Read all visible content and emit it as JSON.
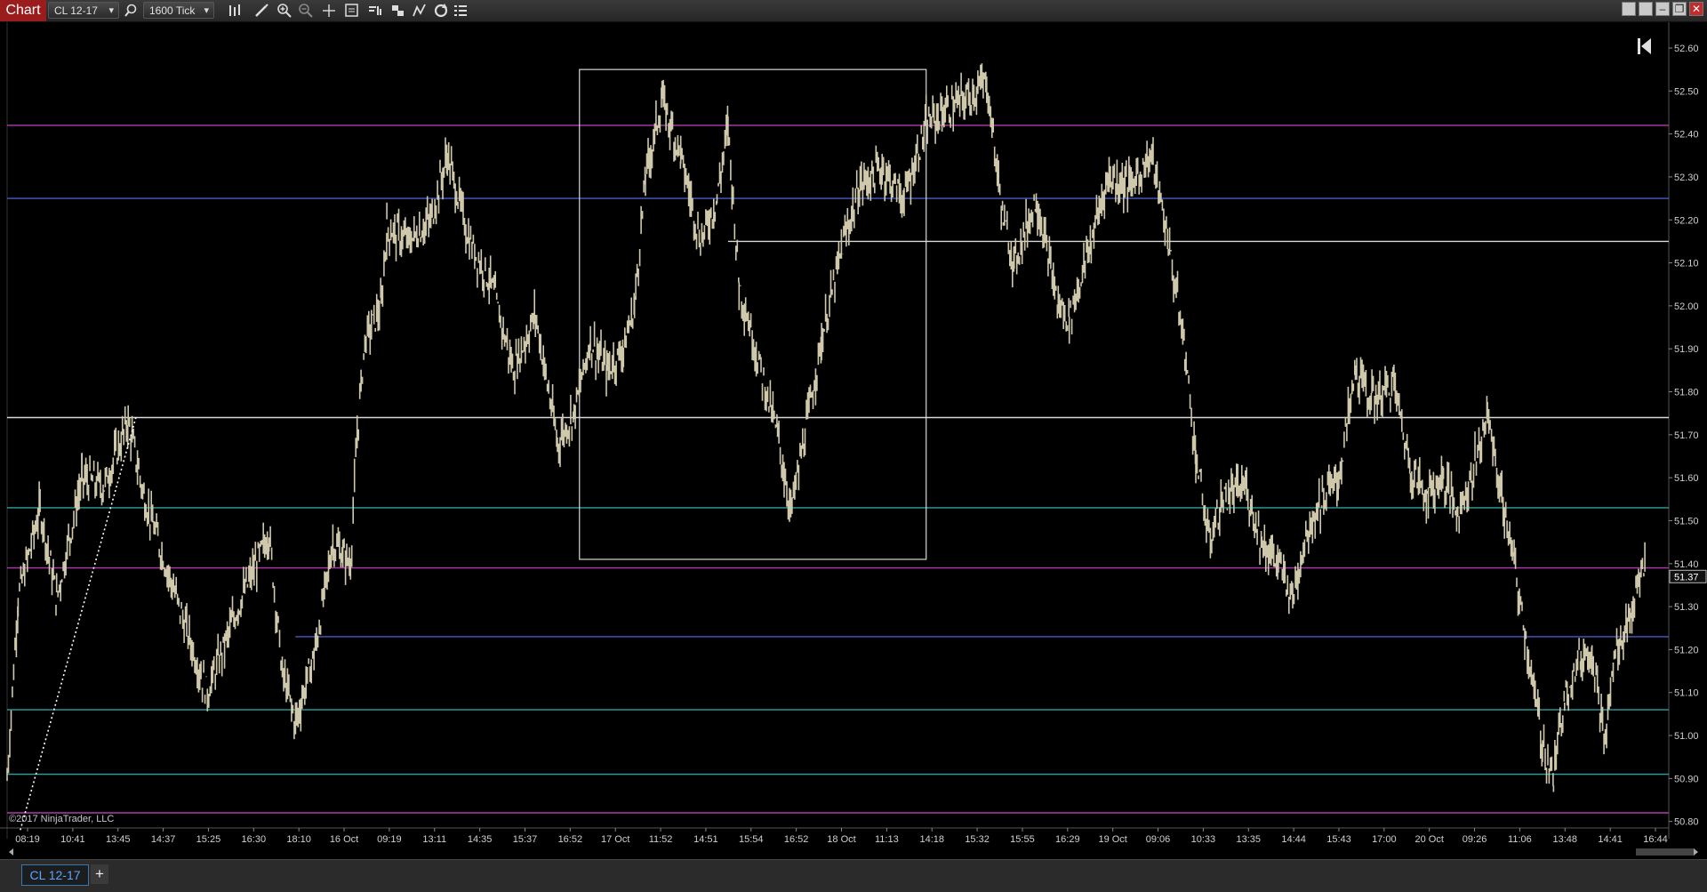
{
  "toolbar": {
    "chart_label": "Chart",
    "instrument": "CL 12-17",
    "interval": "1600 Tick",
    "icons": [
      "search-icon",
      "bar-style-icon",
      "draw-pencil-icon",
      "zoom-in-icon",
      "zoom-out-icon",
      "crosshair-icon",
      "data-box-icon",
      "indicators-icon",
      "strategies-icon",
      "drawing-tools-icon",
      "refresh-icon",
      "properties-icon"
    ],
    "window_buttons": [
      "tile-icon",
      "layout-icon",
      "minimize-icon",
      "restore-icon",
      "close-icon"
    ]
  },
  "colors": {
    "background": "#000000",
    "price_bar": "#cfc8aa",
    "magenta_line": "#b03ab0",
    "blue_line": "#4a5ac8",
    "cyan_line": "#2ca3a0",
    "white_line": "#d8d8d8",
    "accent_tab": "#58a6ff"
  },
  "chart_data": {
    "type": "line",
    "instrument": "CL 12-17",
    "ylim": [
      50.76,
      52.66
    ],
    "y_ticks": [
      "52.60",
      "52.50",
      "52.40",
      "52.30",
      "52.20",
      "52.10",
      "52.00",
      "51.90",
      "51.80",
      "51.70",
      "51.60",
      "51.50",
      "51.40",
      "51.30",
      "51.20",
      "51.10",
      "51.00",
      "50.90",
      "50.80"
    ],
    "x_ticks": [
      "08:19",
      "10:41",
      "13:45",
      "14:37",
      "15:25",
      "16:30",
      "18:10",
      "16 Oct",
      "09:19",
      "13:11",
      "14:35",
      "15:37",
      "16:52",
      "17 Oct",
      "11:52",
      "14:51",
      "15:54",
      "16:52",
      "18 Oct",
      "11:13",
      "14:18",
      "15:32",
      "15:55",
      "16:29",
      "19 Oct",
      "09:06",
      "10:33",
      "13:35",
      "14:44",
      "15:43",
      "17:00",
      "20 Oct",
      "09:26",
      "11:06",
      "13:48",
      "14:41",
      "16:44"
    ],
    "last_price": "51.37",
    "copyright": "©2017 NinjaTrader, LLC",
    "price_path": [
      [
        0,
        50.9
      ],
      [
        10,
        51.32
      ],
      [
        30,
        51.53
      ],
      [
        45,
        51.32
      ],
      [
        68,
        51.6
      ],
      [
        88,
        51.58
      ],
      [
        110,
        51.73
      ],
      [
        125,
        51.55
      ],
      [
        150,
        51.35
      ],
      [
        175,
        51.15
      ],
      [
        182,
        51.1
      ],
      [
        210,
        51.3
      ],
      [
        238,
        51.47
      ],
      [
        250,
        51.15
      ],
      [
        262,
        51.03
      ],
      [
        280,
        51.2
      ],
      [
        296,
        51.45
      ],
      [
        305,
        51.42
      ],
      [
        312,
        51.4
      ],
      [
        318,
        51.7
      ],
      [
        325,
        51.92
      ],
      [
        340,
        52.0
      ],
      [
        345,
        52.18
      ],
      [
        365,
        52.15
      ],
      [
        385,
        52.2
      ],
      [
        400,
        52.35
      ],
      [
        420,
        52.15
      ],
      [
        440,
        52.05
      ],
      [
        460,
        51.85
      ],
      [
        480,
        51.98
      ],
      [
        500,
        51.68
      ],
      [
        515,
        51.75
      ],
      [
        530,
        51.92
      ],
      [
        545,
        51.85
      ],
      [
        560,
        51.9
      ],
      [
        570,
        52.0
      ],
      [
        580,
        52.3
      ],
      [
        595,
        52.48
      ],
      [
        612,
        52.35
      ],
      [
        630,
        52.15
      ],
      [
        645,
        52.25
      ],
      [
        655,
        52.42
      ],
      [
        665,
        52.05
      ],
      [
        685,
        51.85
      ],
      [
        700,
        51.7
      ],
      [
        712,
        51.52
      ],
      [
        725,
        51.7
      ],
      [
        740,
        51.92
      ],
      [
        760,
        52.15
      ],
      [
        775,
        52.28
      ],
      [
        795,
        52.32
      ],
      [
        815,
        52.25
      ],
      [
        835,
        52.42
      ],
      [
        850,
        52.45
      ],
      [
        870,
        52.48
      ],
      [
        890,
        52.52
      ],
      [
        905,
        52.2
      ],
      [
        915,
        52.1
      ],
      [
        935,
        52.25
      ],
      [
        955,
        52.0
      ],
      [
        965,
        51.97
      ],
      [
        985,
        52.15
      ],
      [
        1000,
        52.3
      ],
      [
        1020,
        52.28
      ],
      [
        1040,
        52.35
      ],
      [
        1055,
        52.15
      ],
      [
        1070,
        51.9
      ],
      [
        1080,
        51.65
      ],
      [
        1092,
        51.45
      ],
      [
        1105,
        51.55
      ],
      [
        1125,
        51.58
      ],
      [
        1140,
        51.45
      ],
      [
        1155,
        51.4
      ],
      [
        1168,
        51.32
      ],
      [
        1180,
        51.47
      ],
      [
        1195,
        51.55
      ],
      [
        1210,
        51.6
      ],
      [
        1225,
        51.85
      ],
      [
        1240,
        51.78
      ],
      [
        1260,
        51.82
      ],
      [
        1275,
        51.62
      ],
      [
        1290,
        51.56
      ],
      [
        1305,
        51.6
      ],
      [
        1318,
        51.52
      ],
      [
        1330,
        51.6
      ],
      [
        1345,
        51.75
      ],
      [
        1358,
        51.55
      ],
      [
        1368,
        51.42
      ],
      [
        1380,
        51.22
      ],
      [
        1395,
        50.98
      ],
      [
        1405,
        50.9
      ],
      [
        1415,
        51.1
      ],
      [
        1430,
        51.18
      ],
      [
        1440,
        51.2
      ],
      [
        1452,
        50.98
      ],
      [
        1460,
        51.18
      ],
      [
        1475,
        51.28
      ],
      [
        1488,
        51.4
      ]
    ],
    "horizontal_lines": [
      {
        "price": 52.42,
        "color": "magenta",
        "from": 0
      },
      {
        "price": 52.25,
        "color": "blue",
        "from": 0
      },
      {
        "price": 52.15,
        "color": "white",
        "from": 655
      },
      {
        "price": 51.74,
        "color": "white",
        "from": 0
      },
      {
        "price": 51.53,
        "color": "cyan",
        "from": 0
      },
      {
        "price": 51.39,
        "color": "magenta",
        "from": 0
      },
      {
        "price": 51.23,
        "color": "blue",
        "from": 262
      },
      {
        "price": 51.06,
        "color": "cyan",
        "from": 0
      },
      {
        "price": 50.91,
        "color": "cyan",
        "from": 0
      },
      {
        "price": 50.82,
        "color": "magenta",
        "from": 0
      }
    ],
    "rectangle": {
      "x1": 520,
      "x2": 835,
      "price_top": 52.55,
      "price_bottom": 51.41
    },
    "trendline": {
      "x1": 12,
      "price1": 50.78,
      "x2": 117,
      "price2": 51.74
    }
  },
  "bottom": {
    "tab_label": "CL 12-17",
    "add_tab": "+"
  }
}
